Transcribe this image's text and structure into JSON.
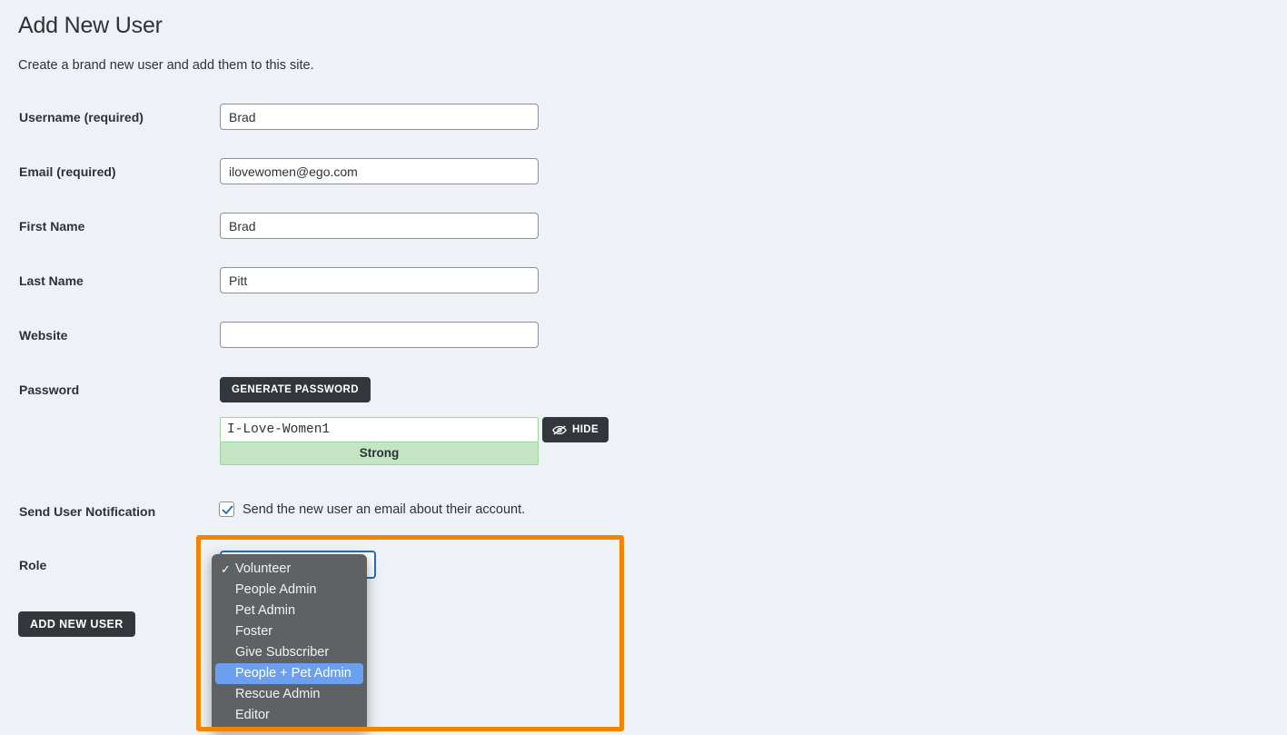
{
  "page": {
    "title": "Add New User",
    "subtitle": "Create a brand new user and add them to this site."
  },
  "form": {
    "fields": [
      {
        "label": "Username (required)",
        "value": "Brad",
        "placeholder": ""
      },
      {
        "label": "Email (required)",
        "value": "ilovewomen@ego.com",
        "placeholder": ""
      },
      {
        "label": "First Name",
        "value": "Brad",
        "placeholder": ""
      },
      {
        "label": "Last Name",
        "value": "Pitt",
        "placeholder": ""
      },
      {
        "label": "Website",
        "value": "",
        "placeholder": ""
      }
    ],
    "password": {
      "label": "Password",
      "generate_button": "GENERATE PASSWORD",
      "value": "I-Love-Women1",
      "strength": "Strong",
      "hide_button": "HIDE",
      "hide_icon": "eye-slash-icon"
    },
    "notification": {
      "label": "Send User Notification",
      "checkbox_label": "Send the new user an email about their account.",
      "checked": true
    },
    "role": {
      "label": "Role",
      "selected": "Volunteer",
      "highlighted": "People + Pet Admin",
      "options": [
        "Volunteer",
        "People Admin",
        "Pet Admin",
        "Foster",
        "Give Subscriber",
        "People + Pet Admin",
        "Rescue Admin",
        "Editor"
      ]
    },
    "submit_button": "ADD NEW USER"
  },
  "colors": {
    "background": "#eef2f6",
    "button_dark": "#32373c",
    "focus_blue": "#2271b1",
    "highlight_orange": "#f28500",
    "dropdown_bg": "#5e6265",
    "dropdown_highlight": "#6c9fee",
    "strength_green": "#c3e5c3"
  }
}
